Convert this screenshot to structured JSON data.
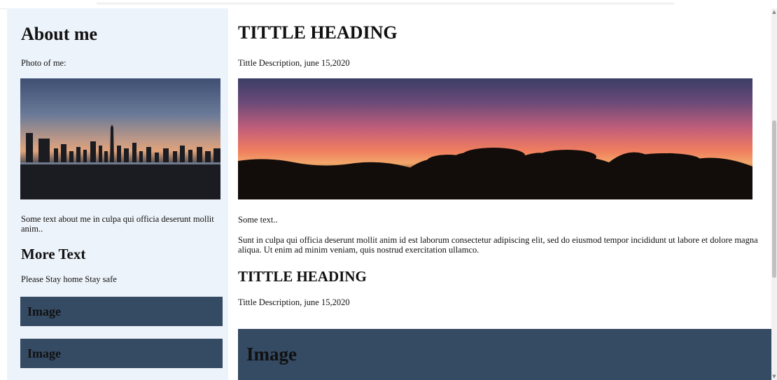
{
  "sidebar": {
    "about_heading": "About me",
    "photo_label": "Photo of me:",
    "about_text": "Some text about me in culpa qui officia deserunt mollit anim..",
    "more_heading": "More Text",
    "more_text": "Please Stay home Stay safe",
    "cards": [
      "Image",
      "Image"
    ]
  },
  "main": {
    "posts": [
      {
        "title": "TITTLE HEADING",
        "description": "Tittle Description, june 15,2020",
        "text_short": "Some text..",
        "text_long": "Sunt in culpa qui officia deserunt mollit anim id est laborum consectetur adipiscing elit, sed do eiusmod tempor incididunt ut labore et dolore magna aliqua. Ut enim ad minim veniam, quis nostrud exercitation ullamco."
      },
      {
        "title": "TITTLE HEADING",
        "description": "Tittle Description, june 15,2020",
        "image_label": "Image"
      }
    ]
  },
  "colors": {
    "sidebar_bg": "#edf3fa",
    "image_card": "#354a63"
  },
  "icons": {
    "scroll_up": "scroll-up-arrow-icon",
    "scroll_down": "scroll-down-arrow-icon"
  }
}
